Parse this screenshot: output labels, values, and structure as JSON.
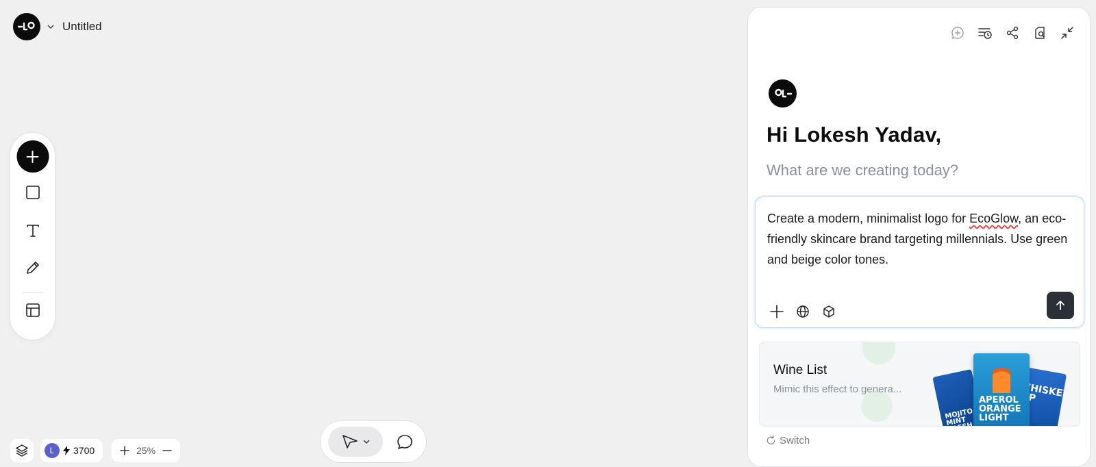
{
  "app": {
    "doc_title": "Untitled"
  },
  "toolbar": {
    "tools": [
      "add-tool",
      "rectangle-tool",
      "text-tool",
      "pen-tool",
      "layout-tool"
    ]
  },
  "bottom_left": {
    "user_initial": "L",
    "credits": "3700",
    "zoom_level": "25%"
  },
  "mode_bar": {
    "active_tool": "select"
  },
  "panel": {
    "greeting": "Hi Lokesh Yadav,",
    "subgreeting": "What are we creating today?",
    "prompt_before": "Create a modern, minimalist logo for ",
    "prompt_misspelled": "EcoGlow",
    "prompt_after": ", an eco-friendly skincare brand targeting millennials. Use green and beige color tones.",
    "suggestion": {
      "title": "Wine List",
      "subtitle": "Mimic this effect to genera...",
      "poster_left": "MOJITO MINT FRESH",
      "poster_mid": "APEROL ORANGE LIGHT",
      "poster_right": "WHISKEY SIP"
    },
    "switch_label": "Switch"
  },
  "colors": {
    "background": "#f0f0f1",
    "accent_dark": "#0b0b0b",
    "send_button": "#2b2f36",
    "prompt_border": "#b9daf3",
    "avatar": "#5a61c9"
  }
}
